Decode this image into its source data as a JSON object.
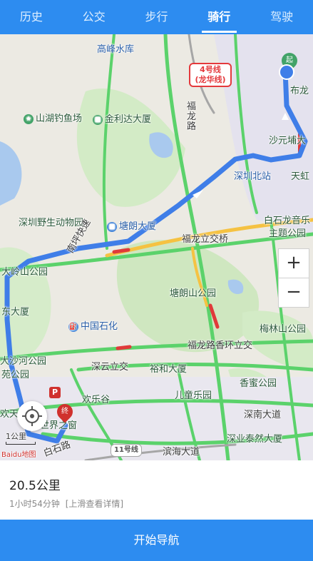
{
  "tabs": [
    {
      "label": "历史"
    },
    {
      "label": "公交"
    },
    {
      "label": "步行"
    },
    {
      "label": "骑行",
      "active": true
    },
    {
      "label": "驾驶"
    }
  ],
  "map": {
    "labels": {
      "gaofeng": "高峰水库",
      "shandiao": "山湖钓鱼场",
      "jinlida": "金利达大厦",
      "longhua_road": "福龙路",
      "shayuan": "沙元埔大",
      "bulong": "布龙",
      "shenzhenbei": "深圳北站",
      "tianhong": "天虹",
      "wildlife": "深圳野生动物园",
      "tanglang_bldg": "塘朗大厦",
      "bailong": "白石龙音乐",
      "theme_park": "主题公园",
      "fulong_bridge": "福龙立交桥",
      "nanping": "南坪快速",
      "daling": "大岭山公园",
      "tanglang_park": "塘朗山公园",
      "dong_bldg": "东大厦",
      "sinopec": "中国石化",
      "meilin": "梅林山公园",
      "fulong_loop": "福龙路香环立交",
      "shahe": "大沙河公园",
      "yuan": "苑公园",
      "shenyun": "深云立交",
      "yuhe": "裕和大厦",
      "children": "儿童乐园",
      "xiangmi": "香蜜公园",
      "happy_valley": "欢乐谷",
      "world": "世界之窗",
      "shennan": "深南大道",
      "tairan": "深业泰然大厦",
      "baishi": "白石路",
      "binhai": "滨海大道",
      "xiaotian": "欢天",
      "scale": "1公里",
      "baidu": "Baidu地图",
      "start_badge": "起",
      "end_badge": "终",
      "parking": "P"
    },
    "metro4": "4号线\n(龙华线)",
    "metro4_line1": "4号线",
    "metro4_line2": "(龙华线)",
    "metro11": "11号线",
    "zoom_in": "+",
    "zoom_out": "−"
  },
  "route": {
    "distance": "20.5公里",
    "duration": "1小时54分钟",
    "hint": "[上滑查看详情]"
  },
  "start_nav_label": "开始导航",
  "colors": {
    "accent": "#2d8cf0",
    "route": "#3f7ee8",
    "green_road": "#5bd26b",
    "yellow_road": "#f5c242",
    "red_road": "#e03a3a"
  }
}
